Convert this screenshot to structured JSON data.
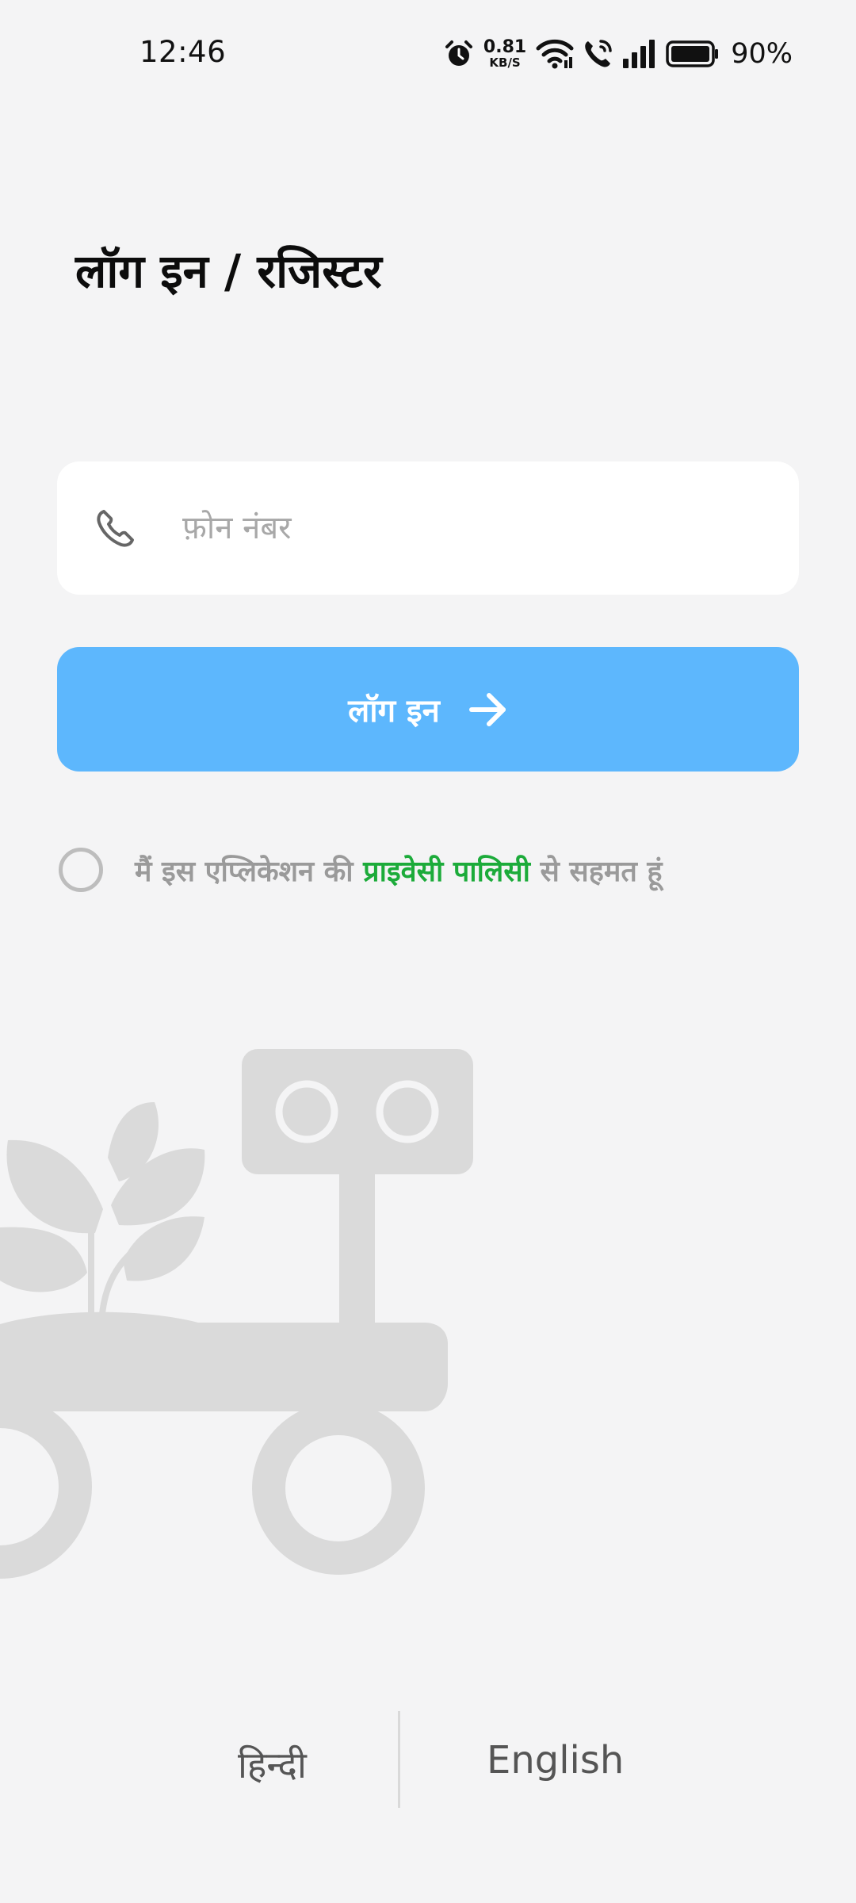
{
  "status_bar": {
    "time": "12:46",
    "net_speed_value": "0.81",
    "net_speed_unit": "KB/S",
    "battery_percent": "90%",
    "icons": [
      "alarm-icon",
      "wifi-icon",
      "wifi-calling-icon",
      "signal-icon",
      "battery-icon"
    ]
  },
  "page": {
    "title": "लॉग इन / रजिस्टर"
  },
  "phone_field": {
    "placeholder": "फ़ोन नंबर",
    "value": "",
    "icon": "phone-icon"
  },
  "login_button": {
    "label": "लॉग इन",
    "icon": "arrow-right-icon",
    "color": "#5db7fd"
  },
  "consent": {
    "text_before": "मैं इस एप्लिकेशन की ",
    "link_text": "प्राइवेसी पालिसी",
    "text_after": " से सहमत हूं",
    "checked": false,
    "link_color": "#1cab3a"
  },
  "illustration": {
    "icon": "robot-plant-illustration"
  },
  "language": {
    "hindi_label": "हिन्दी",
    "english_label": "English"
  },
  "colors": {
    "background": "#f4f4f5",
    "accent": "#5db7fd",
    "link": "#1cab3a"
  }
}
